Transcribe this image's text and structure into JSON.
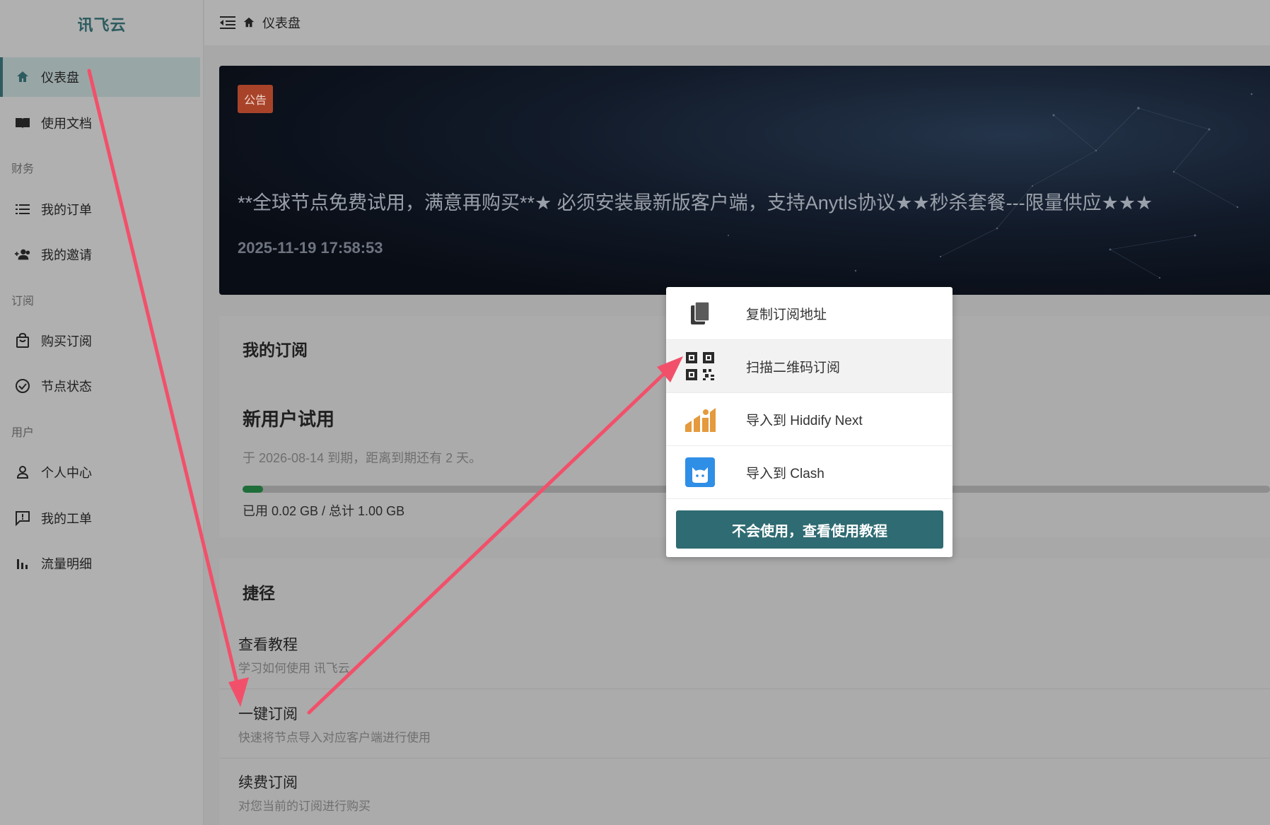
{
  "sidebar": {
    "brand": "讯飞云",
    "items": [
      {
        "label": "仪表盘",
        "icon": "home-icon"
      },
      {
        "label": "使用文档",
        "icon": "book-icon"
      },
      {
        "label": "我的订单",
        "icon": "list-icon"
      },
      {
        "label": "我的邀请",
        "icon": "invite-icon"
      },
      {
        "label": "购买订阅",
        "icon": "shopping-bag-icon"
      },
      {
        "label": "节点状态",
        "icon": "check-circle-icon"
      },
      {
        "label": "个人中心",
        "icon": "user-icon"
      },
      {
        "label": "我的工单",
        "icon": "feedback-icon"
      },
      {
        "label": "流量明细",
        "icon": "bar-chart-icon"
      }
    ],
    "groups": [
      "财务",
      "订阅",
      "用户"
    ]
  },
  "header": {
    "breadcrumb": "仪表盘"
  },
  "announcement": {
    "badge": "公告",
    "text": "**全球节点免费试用，满意再购买**★ 必须安装最新版客户端，支持Anytls协议★★秒杀套餐---限量供应★★★",
    "date": "2025-11-19 17:58:53"
  },
  "subscription": {
    "title": "我的订阅",
    "plan": "新用户试用",
    "expire": "于 2026-08-14 到期，距离到期还有 2 天。",
    "usage_text": "已用 0.02 GB / 总计 1.00 GB",
    "usage_fraction": 0.02
  },
  "shortcuts": {
    "title": "捷径",
    "items": [
      {
        "title": "查看教程",
        "desc": "学习如何使用 讯飞云"
      },
      {
        "title": "一键订阅",
        "desc": "快速将节点导入对应客户端进行使用"
      },
      {
        "title": "续费订阅",
        "desc": "对您当前的订阅进行购买"
      }
    ]
  },
  "menu": {
    "items": [
      {
        "label": "复制订阅地址",
        "icon": "copy-icon"
      },
      {
        "label": "扫描二维码订阅",
        "icon": "qr-code-icon"
      },
      {
        "label": "导入到 Hiddify Next",
        "icon": "hiddify-icon"
      },
      {
        "label": "导入到 Clash",
        "icon": "clash-icon"
      }
    ],
    "button": "不会使用，查看使用教程"
  },
  "colors": {
    "accent": "#2f6b72",
    "annotation_arrow": "#f2506a",
    "badge": "#a8432a",
    "progress": "#1f6e3a"
  }
}
